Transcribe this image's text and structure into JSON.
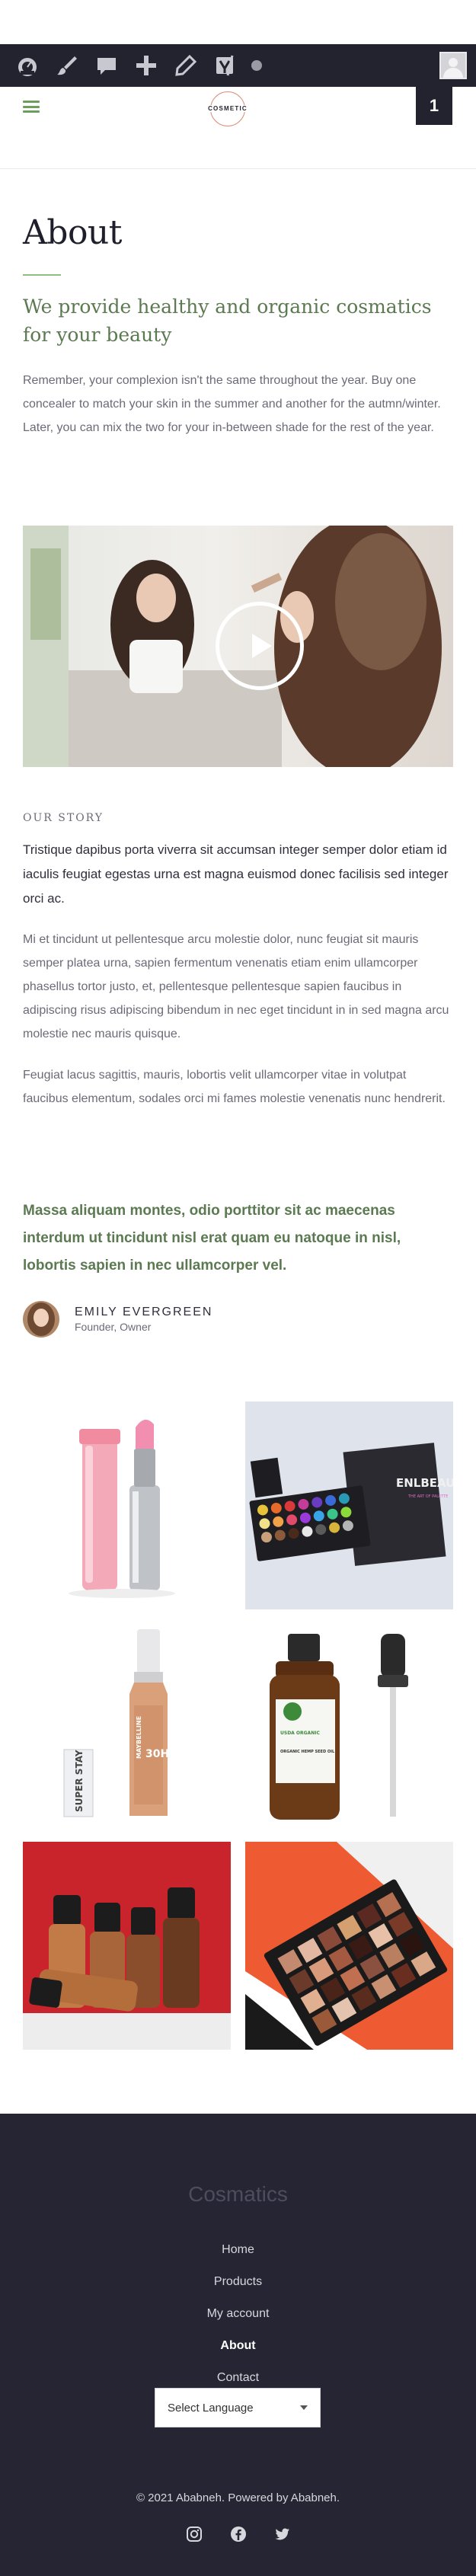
{
  "admin_bar": {
    "icons": [
      "dashboard-icon",
      "customize-brush-icon",
      "comments-icon",
      "new-plus-icon",
      "edit-pencil-icon",
      "seo-y-icon",
      "status-dot-icon",
      "user-avatar-icon"
    ]
  },
  "header": {
    "logo_text": "COSMETIC",
    "cart_count": "1"
  },
  "about": {
    "title": "About",
    "lead": "We provide healthy and organic cosmatics for your beauty",
    "intro": "Remember, your complexion isn't the same throughout the year. Buy one concealer to match your skin in the summer and another for the autmn/winter. Later, you can mix the two for your in-between shade for the rest of the year."
  },
  "story": {
    "kicker": "OUR STORY",
    "p1": "Tristique dapibus porta viverra sit accumsan integer semper dolor etiam id iaculis feugiat egestas urna est magna euismod donec facilisis sed integer orci ac.",
    "p2": "Mi et tincidunt ut pellentesque arcu molestie dolor, nunc feugiat sit mauris semper platea urna, sapien fermentum venenatis etiam enim ullamcorper phasellus tortor justo, et, pellentesque pellentesque sapien faucibus in adipiscing risus adipiscing bibendum in nec eget tincidunt in in sed magna arcu molestie nec mauris quisque.",
    "p3": "Feugiat lacus sagittis, mauris, lobortis velit ullamcorper vitae in volutpat faucibus elementum, sodales orci mi fames molestie venenatis nunc hendrerit."
  },
  "testimonial": {
    "quote": "Massa aliquam montes, odio porttitor sit ac maecenas interdum ut tincidunt nisl erat quam eu natoque in nisl, lobortis sapien in nec ullamcorper vel.",
    "name": "EMILY EVERGREEN",
    "role": "Founder, Owner"
  },
  "gallery": {
    "palette_brand": "ENLBEAUTY",
    "palette_sub": "THE ART OF PALETTE",
    "foundation_brand": "MAYBELLINE",
    "foundation_shade": "30H",
    "stick_text": "SUPER STAY",
    "bottle_label": "USDA ORGANIC",
    "bottle_name": "ORGANIC HEMP SEED OIL"
  },
  "footer": {
    "title": "Cosmatics",
    "menu": [
      "Home",
      "Products",
      "My account",
      "About",
      "Contact"
    ],
    "active_index": 3,
    "language_select": "Select Language",
    "copyright": "© 2021 Ababneh. Powered by Ababneh.",
    "social": [
      "instagram-icon",
      "facebook-icon",
      "twitter-icon"
    ]
  },
  "colors": {
    "accent_green": "#5c7a52",
    "dark": "#23232f",
    "footer_bg": "#262533"
  }
}
